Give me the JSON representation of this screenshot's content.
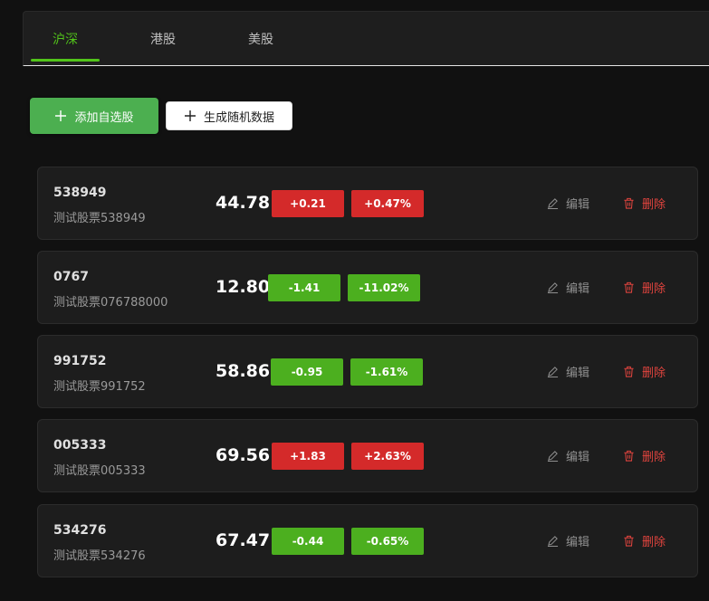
{
  "tabs": [
    {
      "label": "沪深",
      "active": true
    },
    {
      "label": "港股",
      "active": false
    },
    {
      "label": "美股",
      "active": false
    }
  ],
  "toolbar": {
    "add_label": "添加自选股",
    "random_label": "生成随机数据"
  },
  "actions": {
    "edit_label": "编辑",
    "delete_label": "删除"
  },
  "colors": {
    "accent": "#52c41a",
    "up": "#d42a2a",
    "down": "#4caf1f",
    "delete": "#e0443e"
  },
  "icons": {
    "add": "plus-icon",
    "edit": "pencil-icon",
    "delete": "trash-icon"
  },
  "stocks": [
    {
      "code": "538949",
      "name": "测试股票538949",
      "price": "44.78",
      "change": "+0.21",
      "percent": "+0.47%",
      "direction": "up"
    },
    {
      "code": "0767",
      "name": "测试股票076788000",
      "price": "12.80",
      "change": "-1.41",
      "percent": "-11.02%",
      "direction": "down"
    },
    {
      "code": "991752",
      "name": "测试股票991752",
      "price": "58.86",
      "change": "-0.95",
      "percent": "-1.61%",
      "direction": "down"
    },
    {
      "code": "005333",
      "name": "测试股票005333",
      "price": "69.56",
      "change": "+1.83",
      "percent": "+2.63%",
      "direction": "up"
    },
    {
      "code": "534276",
      "name": "测试股票534276",
      "price": "67.47",
      "change": "-0.44",
      "percent": "-0.65%",
      "direction": "down"
    }
  ]
}
